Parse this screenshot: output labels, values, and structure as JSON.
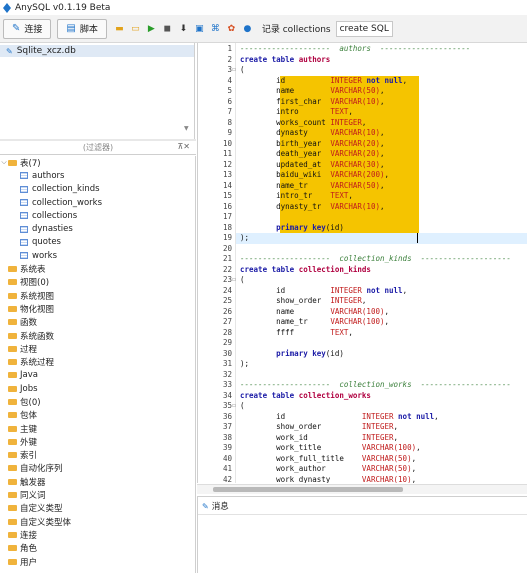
{
  "window": {
    "title": "AnySQL v0.1.19 Beta"
  },
  "toolbar": {
    "connect_label": "连接",
    "script_label": "脚本",
    "icons": [
      "open-folder-icon",
      "save-icon",
      "run-icon",
      "stop-icon",
      "download-icon",
      "format-icon",
      "schema-icon",
      "settings-icon",
      "info-icon"
    ],
    "tabs": [
      {
        "label": "记录 collections",
        "active": false
      },
      {
        "label": "create SQL",
        "active": true
      }
    ]
  },
  "connections": [
    {
      "label": "Sqlite_xcz.db",
      "icon": "database-icon"
    }
  ],
  "filter": {
    "placeholder": "(过滤器)"
  },
  "tree": [
    {
      "label": "表(7)",
      "expanded": true,
      "children": [
        "authors",
        "collection_kinds",
        "collection_works",
        "collections",
        "dynasties",
        "quotes",
        "works"
      ]
    },
    {
      "label": "系统表"
    },
    {
      "label": "视图(0)"
    },
    {
      "label": "系统视图"
    },
    {
      "label": "物化视图"
    },
    {
      "label": "函数"
    },
    {
      "label": "系统函数"
    },
    {
      "label": "过程"
    },
    {
      "label": "系统过程"
    },
    {
      "label": "Java"
    },
    {
      "label": "Jobs"
    },
    {
      "label": "包(0)"
    },
    {
      "label": "包体"
    },
    {
      "label": "主键"
    },
    {
      "label": "外键"
    },
    {
      "label": "索引"
    },
    {
      "label": "自动化序列"
    },
    {
      "label": "触发器"
    },
    {
      "label": "同义词"
    },
    {
      "label": "自定义类型"
    },
    {
      "label": "自定义类型体"
    },
    {
      "label": "连接"
    },
    {
      "label": "角色"
    },
    {
      "label": "用户"
    }
  ],
  "editor": {
    "line_numbers": [
      "1",
      "2",
      "3",
      "4",
      "5",
      "6",
      "7",
      "8",
      "9",
      "10",
      "11",
      "12",
      "13",
      "14",
      "15",
      "16",
      "17",
      "18",
      "19",
      "20",
      "21",
      "22",
      "23",
      "24",
      "25",
      "26",
      "27",
      "28",
      "29",
      "30",
      "31",
      "32",
      "33",
      "34",
      "35",
      "36",
      "37",
      "38",
      "39",
      "40",
      "41",
      "42"
    ],
    "lines": [
      [
        {
          "t": "c",
          "s": "--------------------  authors  --------------------"
        }
      ],
      [
        {
          "t": "k",
          "s": "create table "
        },
        {
          "t": "i",
          "s": "authors"
        }
      ],
      [
        {
          "t": "p",
          "s": "("
        }
      ],
      [
        {
          "t": "p",
          "s": "        id          "
        },
        {
          "t": "y",
          "s": "INTEGER "
        },
        {
          "t": "k",
          "s": "not null"
        },
        {
          "t": "p",
          "s": ","
        }
      ],
      [
        {
          "t": "p",
          "s": "        name        "
        },
        {
          "t": "y",
          "s": "VARCHAR(50)"
        },
        {
          "t": "p",
          "s": ","
        }
      ],
      [
        {
          "t": "p",
          "s": "        first_char  "
        },
        {
          "t": "y",
          "s": "VARCHAR(10)"
        },
        {
          "t": "p",
          "s": ","
        }
      ],
      [
        {
          "t": "p",
          "s": "        intro       "
        },
        {
          "t": "y",
          "s": "TEXT"
        },
        {
          "t": "p",
          "s": ","
        }
      ],
      [
        {
          "t": "p",
          "s": "        works_count "
        },
        {
          "t": "y",
          "s": "INTEGER"
        },
        {
          "t": "p",
          "s": ","
        }
      ],
      [
        {
          "t": "p",
          "s": "        dynasty     "
        },
        {
          "t": "y",
          "s": "VARCHAR(10)"
        },
        {
          "t": "p",
          "s": ","
        }
      ],
      [
        {
          "t": "p",
          "s": "        birth_year  "
        },
        {
          "t": "y",
          "s": "VARCHAR(20)"
        },
        {
          "t": "p",
          "s": ","
        }
      ],
      [
        {
          "t": "p",
          "s": "        death_year  "
        },
        {
          "t": "y",
          "s": "VARCHAR(20)"
        },
        {
          "t": "p",
          "s": ","
        }
      ],
      [
        {
          "t": "p",
          "s": "        updated_at  "
        },
        {
          "t": "y",
          "s": "VARCHAR(30)"
        },
        {
          "t": "p",
          "s": ","
        }
      ],
      [
        {
          "t": "p",
          "s": "        baidu_wiki  "
        },
        {
          "t": "y",
          "s": "VARCHAR(200)"
        },
        {
          "t": "p",
          "s": ","
        }
      ],
      [
        {
          "t": "p",
          "s": "        name_tr     "
        },
        {
          "t": "y",
          "s": "VARCHAR(50)"
        },
        {
          "t": "p",
          "s": ","
        }
      ],
      [
        {
          "t": "p",
          "s": "        intro_tr    "
        },
        {
          "t": "y",
          "s": "TEXT"
        },
        {
          "t": "p",
          "s": ","
        }
      ],
      [
        {
          "t": "p",
          "s": "        dynasty_tr  "
        },
        {
          "t": "y",
          "s": "VARCHAR(10)"
        },
        {
          "t": "p",
          "s": ","
        }
      ],
      [
        {
          "t": "p",
          "s": ""
        }
      ],
      [
        {
          "t": "p",
          "s": "        "
        },
        {
          "t": "k",
          "s": "primary key"
        },
        {
          "t": "p",
          "s": "(id)"
        }
      ],
      [
        {
          "t": "p",
          "s": ");"
        }
      ],
      [
        {
          "t": "p",
          "s": ""
        }
      ],
      [
        {
          "t": "c",
          "s": "--------------------  collection_kinds  --------------------"
        }
      ],
      [
        {
          "t": "k",
          "s": "create table "
        },
        {
          "t": "i",
          "s": "collection_kinds"
        }
      ],
      [
        {
          "t": "p",
          "s": "("
        }
      ],
      [
        {
          "t": "p",
          "s": "        id          "
        },
        {
          "t": "y",
          "s": "INTEGER "
        },
        {
          "t": "k",
          "s": "not null"
        },
        {
          "t": "p",
          "s": ","
        }
      ],
      [
        {
          "t": "p",
          "s": "        show_order  "
        },
        {
          "t": "y",
          "s": "INTEGER"
        },
        {
          "t": "p",
          "s": ","
        }
      ],
      [
        {
          "t": "p",
          "s": "        name        "
        },
        {
          "t": "y",
          "s": "VARCHAR(100)"
        },
        {
          "t": "p",
          "s": ","
        }
      ],
      [
        {
          "t": "p",
          "s": "        name_tr     "
        },
        {
          "t": "y",
          "s": "VARCHAR(100)"
        },
        {
          "t": "p",
          "s": ","
        }
      ],
      [
        {
          "t": "p",
          "s": "        ffff        "
        },
        {
          "t": "y",
          "s": "TEXT"
        },
        {
          "t": "p",
          "s": ","
        }
      ],
      [
        {
          "t": "p",
          "s": ""
        }
      ],
      [
        {
          "t": "p",
          "s": "        "
        },
        {
          "t": "k",
          "s": "primary key"
        },
        {
          "t": "p",
          "s": "(id)"
        }
      ],
      [
        {
          "t": "p",
          "s": ");"
        }
      ],
      [
        {
          "t": "p",
          "s": ""
        }
      ],
      [
        {
          "t": "c",
          "s": "--------------------  collection_works  --------------------"
        }
      ],
      [
        {
          "t": "k",
          "s": "create table "
        },
        {
          "t": "i",
          "s": "collection_works"
        }
      ],
      [
        {
          "t": "p",
          "s": "("
        }
      ],
      [
        {
          "t": "p",
          "s": "        id                 "
        },
        {
          "t": "y",
          "s": "INTEGER "
        },
        {
          "t": "k",
          "s": "not null"
        },
        {
          "t": "p",
          "s": ","
        }
      ],
      [
        {
          "t": "p",
          "s": "        show_order         "
        },
        {
          "t": "y",
          "s": "INTEGER"
        },
        {
          "t": "p",
          "s": ","
        }
      ],
      [
        {
          "t": "p",
          "s": "        work_id            "
        },
        {
          "t": "y",
          "s": "INTEGER"
        },
        {
          "t": "p",
          "s": ","
        }
      ],
      [
        {
          "t": "p",
          "s": "        work_title         "
        },
        {
          "t": "y",
          "s": "VARCHAR(100)"
        },
        {
          "t": "p",
          "s": ","
        }
      ],
      [
        {
          "t": "p",
          "s": "        work_full_title    "
        },
        {
          "t": "y",
          "s": "VARCHAR(50)"
        },
        {
          "t": "p",
          "s": ","
        }
      ],
      [
        {
          "t": "p",
          "s": "        work_author        "
        },
        {
          "t": "y",
          "s": "VARCHAR(50)"
        },
        {
          "t": "p",
          "s": ","
        }
      ],
      [
        {
          "t": "p",
          "s": "        work_dynasty       "
        },
        {
          "t": "y",
          "s": "VARCHAR(10)"
        },
        {
          "t": "p",
          "s": ","
        }
      ]
    ]
  },
  "messages": {
    "tab_label": "消息"
  },
  "colors": {
    "highlight": "#f5c400",
    "keyword": "#1a1aa6",
    "type": "#c01b1b",
    "comment": "#3a7f3a",
    "identifier": "#b00040"
  }
}
